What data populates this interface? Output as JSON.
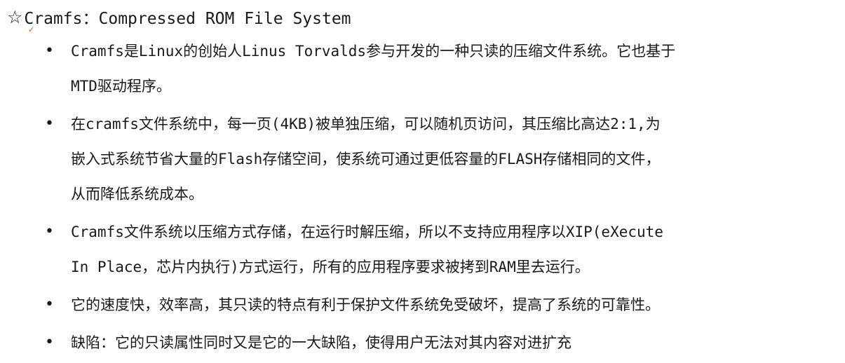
{
  "title": {
    "icon": "star-outline-icon",
    "text": "Cramfs：Compressed ROM File System"
  },
  "bullets": [
    "Cramfs是Linux的创始人Linus Torvalds参与开发的一种只读的压缩文件系统。它也基于\nMTD驱动程序。",
    "在cramfs文件系统中，每一页(4KB)被单独压缩，可以随机页访问，其压缩比高达2:1,为\n嵌入式系统节省大量的Flash存储空间，使系统可通过更低容量的FLASH存储相同的文件，\n从而降低系统成本。",
    "Cramfs文件系统以压缩方式存储，在运行时解压缩，所以不支持应用程序以XIP(eXecute\nIn Place，芯片内执行)方式运行，所有的应用程序要求被拷到RAM里去运行。",
    "它的速度快，效率高，其只读的特点有利于保护文件系统免受破坏，提高了系统的可靠性。",
    "缺陷：它的只读属性同时又是它的一大缺陷，使得用户无法对其内容对进扩充"
  ],
  "bullet_symbol": "•"
}
